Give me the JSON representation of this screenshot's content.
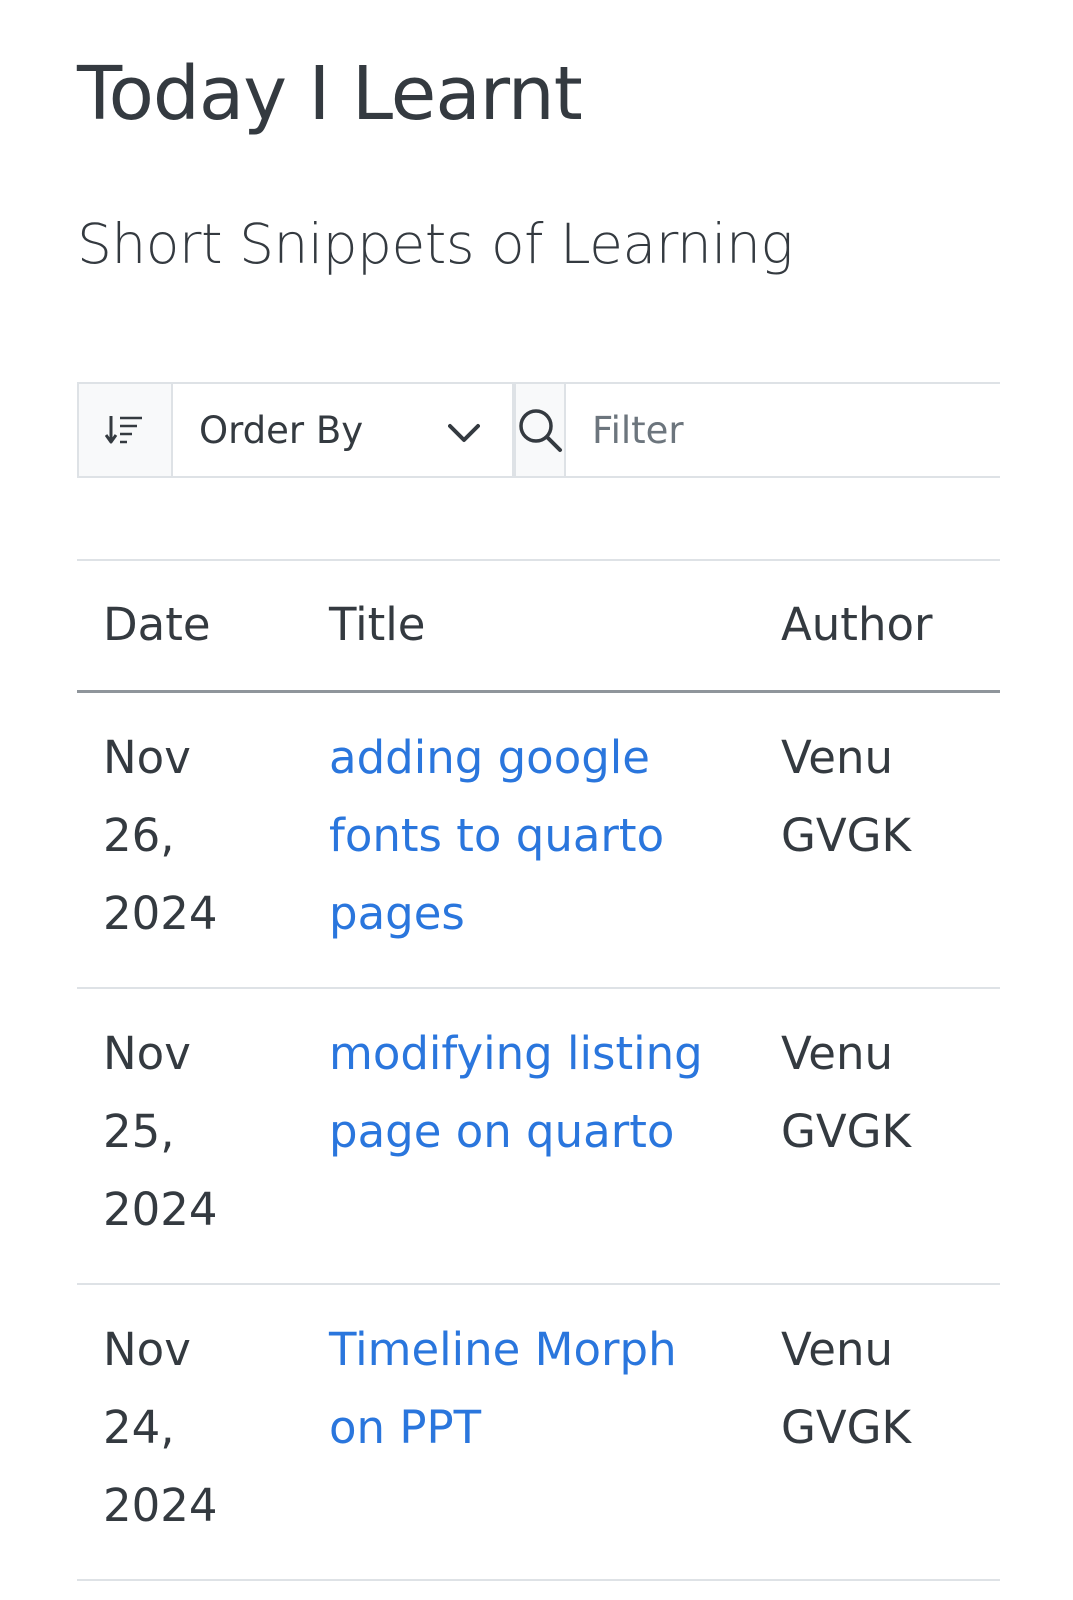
{
  "header": {
    "title": "Today I Learnt",
    "subtitle": "Short Snippets of Learning"
  },
  "controls": {
    "sort_icon": "sort-descending-icon",
    "order_by_label": "Order By",
    "dropdown_icon": "chevron-down-icon",
    "search_icon": "search-icon",
    "filter_placeholder": "Filter"
  },
  "table": {
    "columns": [
      "Date",
      "Title",
      "Author"
    ],
    "rows": [
      {
        "date": "Nov 26, 2024",
        "title": "adding google fonts to quarto pages",
        "author": "Venu GVGK"
      },
      {
        "date": "Nov 25, 2024",
        "title": "modifying listing page on quarto",
        "author": "Venu GVGK"
      },
      {
        "date": "Nov 24, 2024",
        "title": "Timeline Morph on PPT",
        "author": "Venu GVGK"
      }
    ]
  },
  "colors": {
    "link": "#2a76dd",
    "text": "#343a40",
    "border": "#dee2e6",
    "addon_bg": "#f8f9fa"
  }
}
